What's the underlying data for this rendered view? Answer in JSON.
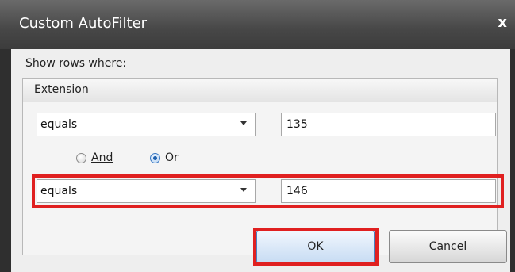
{
  "window": {
    "title": "Custom AutoFilter",
    "close_label": "x"
  },
  "dialog": {
    "show_rows_label": "Show rows where:",
    "group_label": "Extension",
    "condition1": {
      "operator": "equals",
      "value": "135"
    },
    "logic": {
      "and_label": "And",
      "or_label": "Or",
      "selected": "Or"
    },
    "condition2": {
      "operator": "equals",
      "value": "146"
    },
    "buttons": {
      "ok_label": "OK",
      "cancel_label": "Cancel"
    }
  },
  "colors": {
    "highlight": "#e02020",
    "titlebar": "#474747"
  }
}
